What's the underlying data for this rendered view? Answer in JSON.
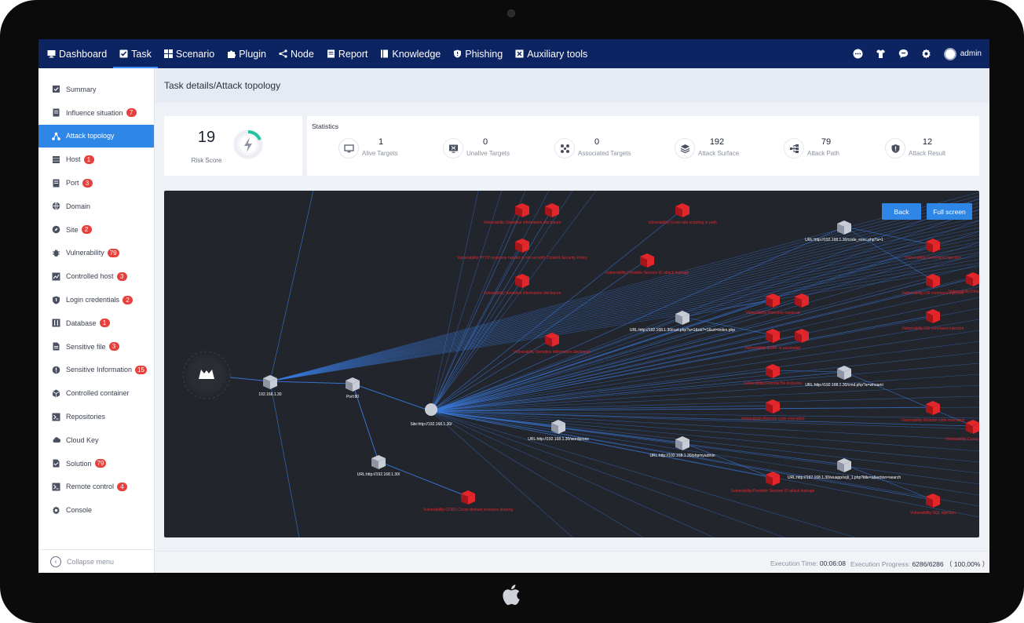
{
  "nav": {
    "items": [
      {
        "label": "Dashboard",
        "icon": "monitor-icon",
        "active": false
      },
      {
        "label": "Task",
        "icon": "checkbox-icon",
        "active": true
      },
      {
        "label": "Scenario",
        "icon": "grid-icon",
        "active": false
      },
      {
        "label": "Plugin",
        "icon": "puzzle-icon",
        "active": false
      },
      {
        "label": "Node",
        "icon": "share-nodes-icon",
        "active": false
      },
      {
        "label": "Report",
        "icon": "report-icon",
        "active": false
      },
      {
        "label": "Knowledge",
        "icon": "book-icon",
        "active": false
      },
      {
        "label": "Phishing",
        "icon": "shield-icon",
        "active": false
      },
      {
        "label": "Auxiliary tools",
        "icon": "toolbox-icon",
        "active": false
      }
    ],
    "user": "admin"
  },
  "sidebar": {
    "items": [
      {
        "label": "Summary",
        "badge": "",
        "icon": "summary-icon"
      },
      {
        "label": "Influence situation",
        "badge": "7",
        "icon": "document-icon"
      },
      {
        "label": "Attack topology",
        "badge": "",
        "icon": "topology-icon",
        "active": true
      },
      {
        "label": "Host",
        "badge": "1",
        "icon": "server-icon"
      },
      {
        "label": "Port",
        "badge": "3",
        "icon": "port-icon"
      },
      {
        "label": "Domain",
        "badge": "",
        "icon": "globe-icon"
      },
      {
        "label": "Site",
        "badge": "2",
        "icon": "compass-icon"
      },
      {
        "label": "Vulnerability",
        "badge": "79",
        "icon": "bug-icon"
      },
      {
        "label": "Controlled host",
        "badge": "3",
        "icon": "chart-icon"
      },
      {
        "label": "Login credentials",
        "badge": "2",
        "icon": "shield-icon"
      },
      {
        "label": "Database",
        "badge": "1",
        "icon": "database-icon"
      },
      {
        "label": "Sensitive file",
        "badge": "3",
        "icon": "file-icon"
      },
      {
        "label": "Sensitive Information",
        "badge": "15",
        "icon": "alert-icon"
      },
      {
        "label": "Controlled container",
        "badge": "",
        "icon": "container-icon"
      },
      {
        "label": "Repositories",
        "badge": "",
        "icon": "terminal-icon"
      },
      {
        "label": "Cloud Key",
        "badge": "",
        "icon": "cloud-icon"
      },
      {
        "label": "Solution",
        "badge": "79",
        "icon": "solution-icon"
      },
      {
        "label": "Remote control",
        "badge": "4",
        "icon": "terminal-icon"
      },
      {
        "label": "Console",
        "badge": "",
        "icon": "gear-icon"
      }
    ],
    "collapse_label": "Collapse menu"
  },
  "header": {
    "breadcrumb": "Task details/Attack topology"
  },
  "risk": {
    "score": "19",
    "label": "Risk Score",
    "gauge_fraction": 0.19,
    "gauge_color": "#21c3a0"
  },
  "stats": {
    "title": "Statistics",
    "items": [
      {
        "value": "1",
        "label": "Alive Targets",
        "icon": "monitor-icon"
      },
      {
        "value": "0",
        "label": "Unalive Targets",
        "icon": "monitor-off-icon"
      },
      {
        "value": "0",
        "label": "Associated Targets",
        "icon": "cluster-icon"
      },
      {
        "value": "192",
        "label": "Attack Surface",
        "icon": "layers-icon"
      },
      {
        "value": "79",
        "label": "Attack Path",
        "icon": "path-icon"
      },
      {
        "value": "12",
        "label": "Attack Result",
        "icon": "shield-result-icon"
      }
    ]
  },
  "topology": {
    "back_label": "Back",
    "fullscreen_label": "Full screen",
    "colors": {
      "background": "#22252c",
      "edge": "#3a7be0",
      "vuln": "#e3262a",
      "node": "#c7ccd6",
      "label": "#ffffff"
    },
    "nodes": [
      {
        "id": "root",
        "label": "",
        "kind": "root"
      },
      {
        "id": "host",
        "label": "192.168.1.30",
        "kind": "host"
      },
      {
        "id": "port",
        "label": "Port:80",
        "kind": "host"
      },
      {
        "id": "site",
        "label": "Site:http://192.168.1.30/",
        "kind": "site"
      },
      {
        "id": "url_root",
        "label": "URL:http://192.168.1.30/",
        "kind": "host"
      },
      {
        "id": "url_wp",
        "label": "URL:http://192.168.1.30/wordpress",
        "kind": "host"
      },
      {
        "id": "url_curl",
        "label": "URL:http://192.168.1.30/curl.php?a=1&ok?=1&url=index.php",
        "kind": "host"
      },
      {
        "id": "url_code",
        "label": "URL:http://192.168.1.30/code_exec.php?a=1",
        "kind": "host"
      },
      {
        "id": "url_cmd",
        "label": "URL:http://192.168.1.30/cmd.php?a=whoami",
        "kind": "host"
      },
      {
        "id": "url_pma",
        "label": "URL:http://192.168.1.30/phpmyadmin",
        "kind": "host"
      },
      {
        "id": "url_search",
        "label": "URL:http://192.168.1.30/wuapp/sqli_1.php?title=a&action=search",
        "kind": "host"
      },
      {
        "id": "v1",
        "label": "Vulnerability:CORS Cross-domain resource sharing",
        "kind": "vuln"
      },
      {
        "id": "v2",
        "label": "Vulnerability:Sensitive information disclosure",
        "kind": "vuln"
      },
      {
        "id": "v3",
        "label": "",
        "kind": "vuln"
      },
      {
        "id": "v4",
        "label": "Vulnerability:HTTP response header is not set with Content-Security-Policy",
        "kind": "vuln"
      },
      {
        "id": "v5",
        "label": "Vulnerability:Sensitive information disclosure",
        "kind": "vuln"
      },
      {
        "id": "v6",
        "label": "Vulnerability:Sensitive information disclosure",
        "kind": "vuln"
      },
      {
        "id": "v7",
        "label": "Vulnerability:Possible Session ID attack leakage",
        "kind": "vuln"
      },
      {
        "id": "v8",
        "label": "Vulnerability:Cross-site scripting in path",
        "kind": "vuln"
      },
      {
        "id": "v9",
        "label": "Vulnerability:Directory traversal",
        "kind": "vuln"
      },
      {
        "id": "v10",
        "label": "",
        "kind": "vuln"
      },
      {
        "id": "v11",
        "label": "Vulnerability:SSRF in parameter",
        "kind": "vuln"
      },
      {
        "id": "v12",
        "label": "",
        "kind": "vuln"
      },
      {
        "id": "v13",
        "label": "Vulnerability:Remote file inclusion",
        "kind": "vuln"
      },
      {
        "id": "v14",
        "label": "Vulnerability:Remote code execution",
        "kind": "vuln"
      },
      {
        "id": "v15",
        "label": "Vulnerability:Command injection",
        "kind": "vuln"
      },
      {
        "id": "v16",
        "label": "Vulnerability:OS command injection",
        "kind": "vuln"
      },
      {
        "id": "v17",
        "label": "Vulnerability:OS command injection",
        "kind": "vuln"
      },
      {
        "id": "v18",
        "label": "Vulnerability:Possible Session ID attack leakage",
        "kind": "vuln"
      },
      {
        "id": "v19",
        "label": "Vulnerability:SQL injection",
        "kind": "vuln"
      },
      {
        "id": "v20",
        "label": "Vulnerability:Remote code execution",
        "kind": "vuln"
      },
      {
        "id": "v21",
        "label": "Vulnerability:Directory listing",
        "kind": "vuln"
      },
      {
        "id": "v22",
        "label": "Vulnerability:Cross-site scripting",
        "kind": "vuln"
      }
    ]
  },
  "status": {
    "exec_time_label": "Execution Time:",
    "exec_time": "00:06:08",
    "progress_label": "Execution Progress:",
    "progress_value": "6286/6286",
    "progress_percent": "（ 100.00% ）"
  }
}
